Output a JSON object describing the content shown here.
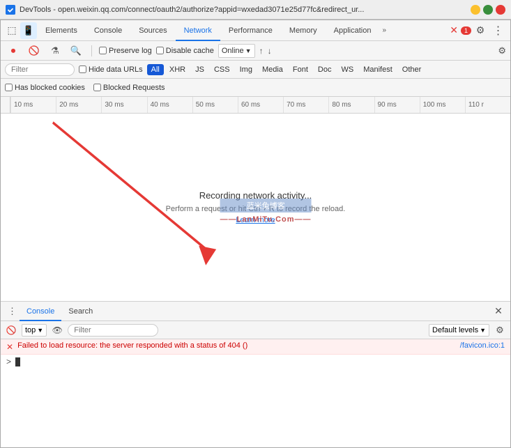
{
  "title_bar": {
    "title": "DevTools - open.weixin.qq.com/connect/oauth2/authorize?appid=wxedad3071e25d77fc&redirect_ur...",
    "icon": "devtools"
  },
  "main_tabs": {
    "items": [
      {
        "label": "Elements",
        "active": false
      },
      {
        "label": "Console",
        "active": false
      },
      {
        "label": "Sources",
        "active": false
      },
      {
        "label": "Network",
        "active": true
      },
      {
        "label": "Performance",
        "active": false
      },
      {
        "label": "Memory",
        "active": false
      },
      {
        "label": "Application",
        "active": false
      }
    ],
    "overflow": "»",
    "badge": "1",
    "gear_label": "⚙",
    "dots_label": "⋮"
  },
  "network_toolbar": {
    "preserve_log_label": "Preserve log",
    "disable_cache_label": "Disable cache",
    "online_label": "Online",
    "dropdown_arrow": "▼",
    "upload_icon": "↑",
    "download_icon": "↓",
    "gear_icon": "⚙"
  },
  "filter_bar": {
    "filter_placeholder": "Filter",
    "hide_data_urls_label": "Hide data URLs",
    "type_buttons": [
      {
        "label": "All",
        "active": true
      },
      {
        "label": "XHR",
        "active": false
      },
      {
        "label": "JS",
        "active": false
      },
      {
        "label": "CSS",
        "active": false
      },
      {
        "label": "Img",
        "active": false
      },
      {
        "label": "Media",
        "active": false
      },
      {
        "label": "Font",
        "active": false
      },
      {
        "label": "Doc",
        "active": false
      },
      {
        "label": "WS",
        "active": false
      },
      {
        "label": "Manifest",
        "active": false
      },
      {
        "label": "Other",
        "active": false
      }
    ]
  },
  "blocked_bar": {
    "has_blocked_cookies_label": "Has blocked cookies",
    "blocked_requests_label": "Blocked Requests"
  },
  "timeline": {
    "ticks": [
      "10 ms",
      "20 ms",
      "30 ms",
      "40 ms",
      "50 ms",
      "60 ms",
      "70 ms",
      "80 ms",
      "90 ms",
      "100 ms",
      "110 r"
    ]
  },
  "network_empty": {
    "title": "Recording network activity...",
    "subtitle": "Perform a request or hit Ctrl + R to record the reload.",
    "link_text": "Learn more"
  },
  "watermark": {
    "box_text": "蓝米兔博客",
    "line1": "——LanMiTu.Com——"
  },
  "console_panel": {
    "tabs": [
      {
        "label": "Console",
        "active": true
      },
      {
        "label": "Search",
        "active": false
      }
    ],
    "dots": "⋮",
    "close": "✕"
  },
  "console_toolbar": {
    "clear_icon": "🚫",
    "top_label": "top",
    "dropdown_arrow": "▼",
    "eye_icon": "👁",
    "filter_placeholder": "Filter",
    "default_levels": "Default levels",
    "levels_arrow": "▼",
    "gear_icon": "⚙"
  },
  "console_errors": [
    {
      "icon": "✕",
      "text": "Failed to load resource: the server responded with a status of 404 ()",
      "source": "/favicon.ico:1"
    }
  ],
  "console_prompt": {
    "icon": ">"
  }
}
